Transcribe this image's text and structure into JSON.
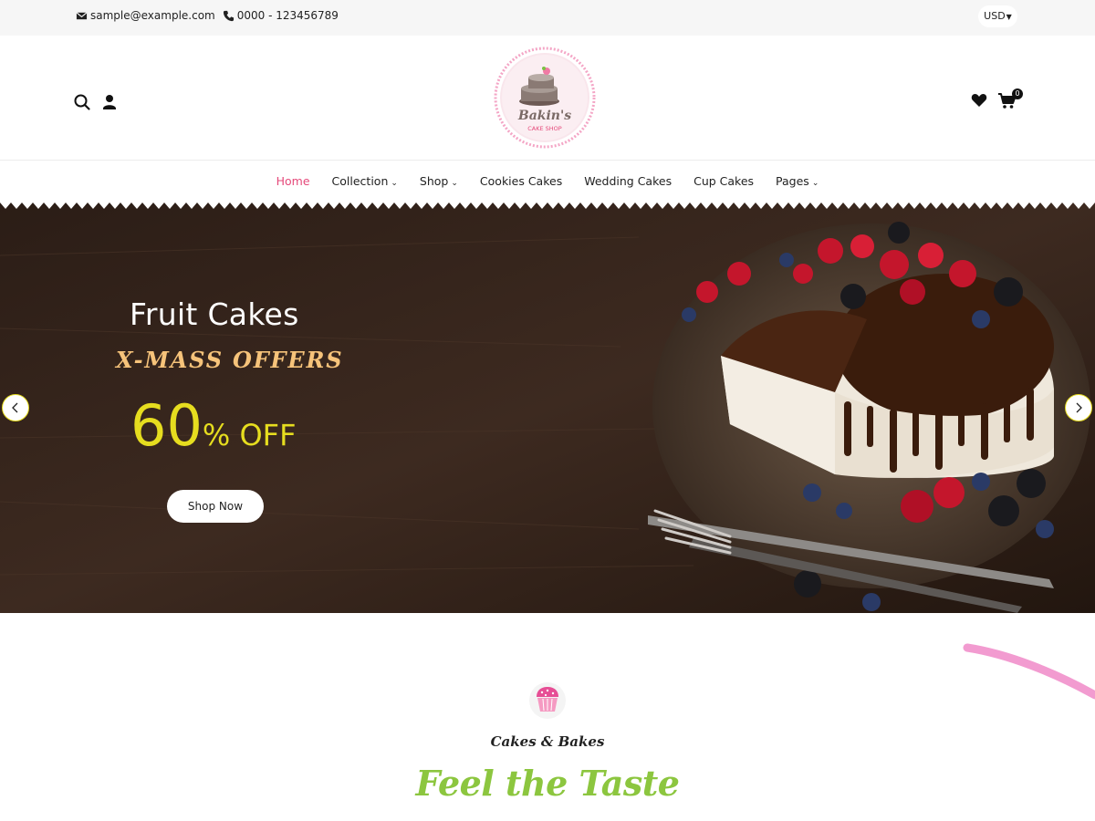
{
  "topbar": {
    "email": "sample@example.com",
    "phone": "0000 - 123456789",
    "currency": "USD"
  },
  "header": {
    "logo_text": "Bakin's",
    "logo_subtext": "CAKE SHOP",
    "cart_count": "0"
  },
  "nav": {
    "items": [
      {
        "label": "Home",
        "active": true
      },
      {
        "label": "Collection",
        "dropdown": true
      },
      {
        "label": "Shop",
        "dropdown": true
      },
      {
        "label": "Cookies Cakes"
      },
      {
        "label": "Wedding Cakes"
      },
      {
        "label": "Cup Cakes"
      },
      {
        "label": "Pages",
        "dropdown": true
      }
    ]
  },
  "hero": {
    "title": "Fruit Cakes",
    "offer": "X-MASS OFFERS",
    "discount_value": "60",
    "discount_suffix": "% OFF",
    "button_label": "Shop Now"
  },
  "section": {
    "subtitle": "Cakes & Bakes",
    "title": "Feel the Taste"
  },
  "colors": {
    "accent_pink": "#e5497a",
    "offer_gold": "#f6c37a",
    "discount_yellow": "#e6dd1f",
    "title_green": "#8cc63f"
  }
}
